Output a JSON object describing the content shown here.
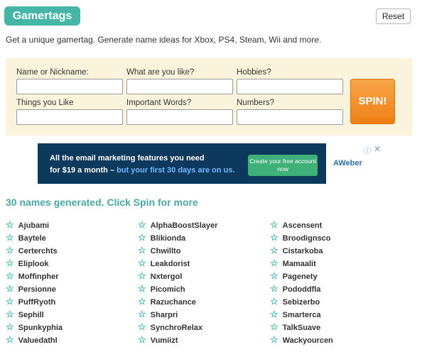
{
  "header": {
    "title": "Gamertags",
    "reset_label": "Reset"
  },
  "intro": "Get a unique gamertag. Generate name ideas for Xbox, PS4, Steam, Wii and more.",
  "form": {
    "fields": [
      {
        "label": "Name or Nickname:",
        "value": ""
      },
      {
        "label": "What are you like?",
        "value": ""
      },
      {
        "label": "Hobbies?",
        "value": ""
      },
      {
        "label": "Things you Like",
        "value": ""
      },
      {
        "label": "Important Words?",
        "value": ""
      },
      {
        "label": "Numbers?",
        "value": ""
      }
    ],
    "spin_label": "SPIN!"
  },
  "ad": {
    "line1": "All the email marketing features you need",
    "line2_prefix": "for $19 a month –",
    "line2_highlight": "but your first 30 days are on us.",
    "cta": "Create your free account now",
    "brand": "AWeber",
    "info_icon": "info-icon",
    "close_icon": "close-icon"
  },
  "results": {
    "heading": "30 names generated. Click Spin for more",
    "icon": "star-icon",
    "columns": [
      [
        "Ajubami",
        "Baytele",
        "Certerchts",
        "Eliplook",
        "Moffinpher",
        "Persionne",
        "PuffRyoth",
        "Sephill",
        "Spunkyphia",
        "Valuedathl"
      ],
      [
        "AlphaBoostSlayer",
        "Blikionda",
        "Chwillto",
        "Leakdorist",
        "Nxtergol",
        "Picomich",
        "Razuchance",
        "Sharpri",
        "SynchroRelax",
        "Vumiizt"
      ],
      [
        "Ascensent",
        "Broodignsco",
        "Cistarkoba",
        "Mamaalit",
        "Pagenety",
        "Pododdfla",
        "Sebizerbo",
        "Smarterca",
        "TalkSuave",
        "Wackyourcen"
      ]
    ]
  }
}
